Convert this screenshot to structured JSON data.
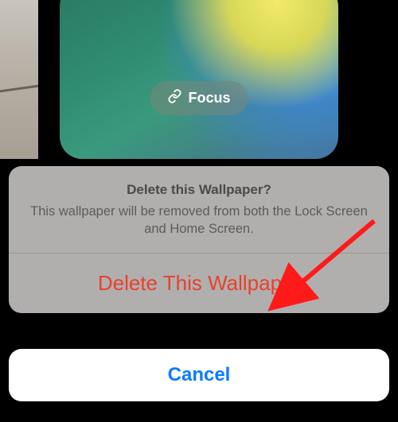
{
  "wallpaper_preview": {
    "focus_pill_label": "Focus"
  },
  "action_sheet": {
    "title": "Delete this Wallpaper?",
    "message": "This wallpaper will be removed from both the Lock Screen and Home Screen.",
    "destructive_action_label": "Delete This Wallpaper",
    "cancel_label": "Cancel"
  },
  "colors": {
    "destructive": "#e8412f",
    "accent": "#0a7bff"
  }
}
